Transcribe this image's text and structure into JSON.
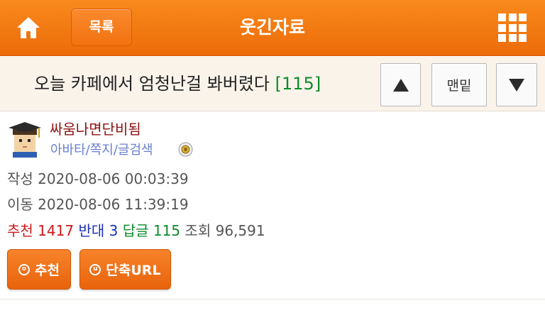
{
  "header": {
    "home_icon": "home-icon",
    "list_label": "목록",
    "title": "웃긴자료",
    "menu_icon": "grid-menu-icon"
  },
  "post": {
    "title": "오늘 카페에서 엄청난걸 봐버렸다",
    "comment_count": "[115]",
    "nav": {
      "bottom_label": "맨밑"
    }
  },
  "author": {
    "name": "싸움나면단비됨",
    "links": "아바타/쪽지/글검색"
  },
  "meta": {
    "written": "작성 2020-08-06 00:03:39",
    "moved": "이동 2020-08-06 11:39:19"
  },
  "stats": {
    "recommend_label": "추천",
    "recommend_value": "1417",
    "oppose_label": "반대",
    "oppose_value": "3",
    "reply_label": "답글",
    "reply_value": "115",
    "views_label": "조회",
    "views_value": "96,591"
  },
  "actions": {
    "recommend_label": "추천",
    "recommend_icon_glyph": "o",
    "shorturl_label": "단축URL",
    "shorturl_icon_glyph": "u"
  },
  "colors": {
    "accent": "#f07a14",
    "recommend": "#cc1a1a",
    "oppose": "#1a2fb5",
    "reply": "#0b8a2a",
    "author": "#8c1010",
    "link": "#6a7fd0"
  }
}
